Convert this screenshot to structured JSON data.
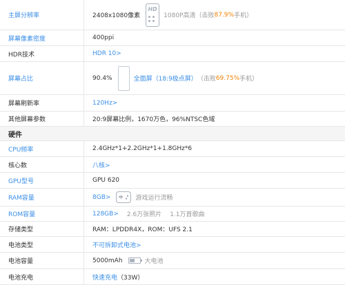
{
  "display": {
    "resolution": {
      "label": "主屏分辨率",
      "value": "2408x1080像素",
      "hd_icon": "HD",
      "note_prefix": "1080P高清（击败",
      "note_percent": "87.9%",
      "note_suffix": "手机）"
    },
    "density": {
      "label": "屏幕像素密度",
      "value": "400ppi"
    },
    "hdr": {
      "label": "HDR技术",
      "value": "HDR 10>"
    },
    "ratio": {
      "label": "屏幕占比",
      "value": "90.4%",
      "note_link": "全面屏（18:9极点屏）",
      "note_prefix": "（击败",
      "note_percent": "69.75%",
      "note_suffix": "手机）"
    },
    "refresh": {
      "label": "屏幕刷新率",
      "value": "120Hz>"
    },
    "other": {
      "label": "其他屏幕参数",
      "value": "20:9屏幕比例，1670万色，96%NTSC色域"
    }
  },
  "hardware": {
    "section_title": "硬件",
    "cpu_freq": {
      "label": "CPU频率",
      "value": "2.4GHz*1+2.2GHz*1+1.8GHz*6"
    },
    "cores": {
      "label": "核心数",
      "value": "八核>"
    },
    "gpu": {
      "label": "GPU型号",
      "value": "GPU 620"
    },
    "ram": {
      "label": "RAM容量",
      "value": "8GB>",
      "note": "游戏运行流畅"
    },
    "rom": {
      "label": "ROM容量",
      "value": "128GB>",
      "note1": "2.6万张照片",
      "note2": "1.1万首歌曲"
    },
    "storage": {
      "label": "存储类型",
      "value": "RAM：LPDDR4X，ROM：UFS 2.1"
    },
    "battery_type": {
      "label": "电池类型",
      "value": "不可拆卸式电池>"
    },
    "battery_capacity": {
      "label": "电池容量",
      "value": "5000mAh",
      "note": "大电池"
    },
    "charging": {
      "label": "电池充电",
      "value": "快速充电",
      "value_suffix": "（33W）"
    }
  }
}
